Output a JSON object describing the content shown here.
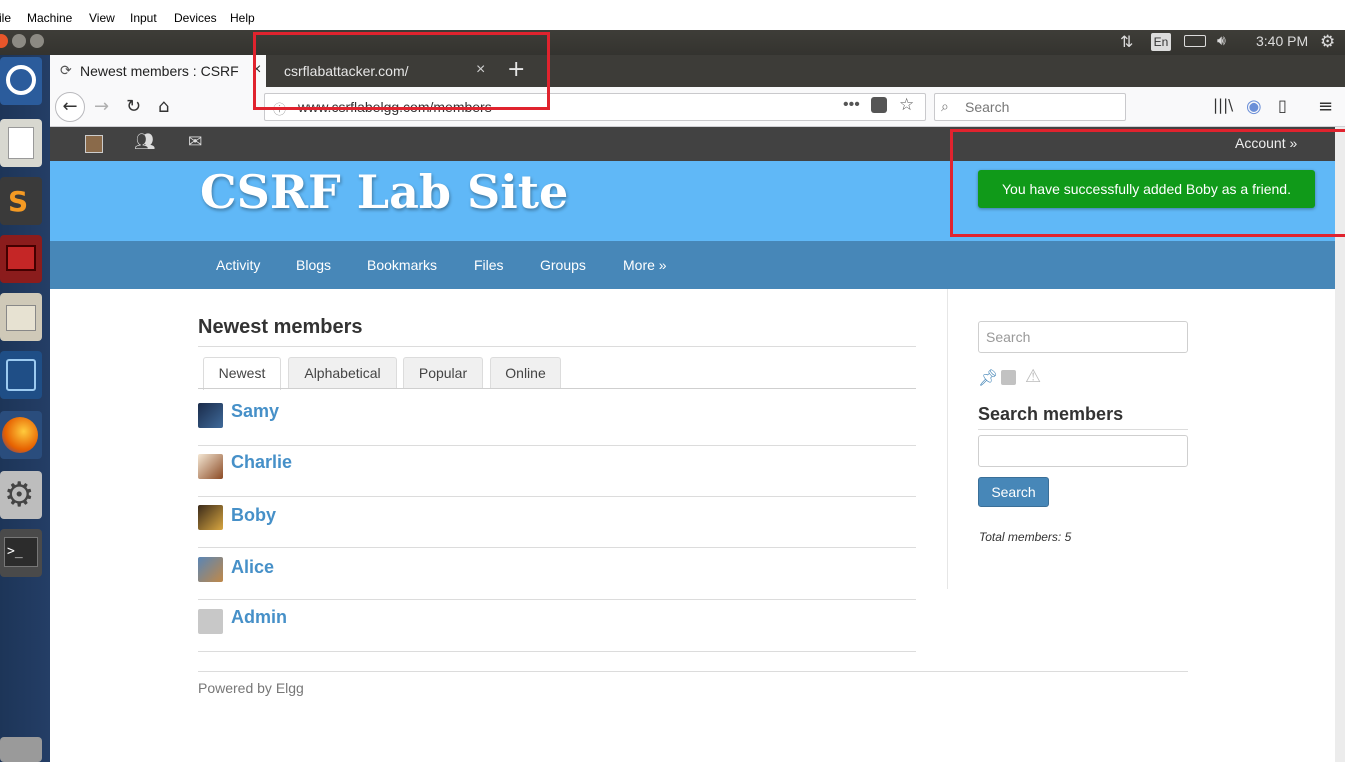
{
  "vbox_menu": [
    "ile",
    "Machine",
    "View",
    "Input",
    "Devices",
    "Help"
  ],
  "panel": {
    "keyboard": "En",
    "time": "3:40 PM"
  },
  "tabs": [
    {
      "title": "Newest members : CSRF"
    },
    {
      "title": "csrflabattacker.com/"
    }
  ],
  "url": "www.csrflabelgg.com/members",
  "browser_search_placeholder": "Search",
  "topbar": {
    "account": "Account »"
  },
  "site": {
    "title": "CSRF Lab Site"
  },
  "menu": [
    "Activity",
    "Blogs",
    "Bookmarks",
    "Files",
    "Groups",
    "More »"
  ],
  "message": "You have successfully added Boby as a friend.",
  "page_title": "Newest members",
  "filter_tabs": [
    "Newest",
    "Alphabetical",
    "Popular",
    "Online"
  ],
  "members": [
    "Samy",
    "Charlie",
    "Boby",
    "Alice",
    "Admin"
  ],
  "sidebar": {
    "search_placeholder": "Search",
    "search_members_title": "Search members",
    "search_button": "Search",
    "total_members": "Total members: 5"
  },
  "footer": "Powered by Elgg",
  "colors": {
    "header": "#60b8f7",
    "menu": "#4787b8",
    "success": "#109a19",
    "highlight": "#e0232e"
  }
}
